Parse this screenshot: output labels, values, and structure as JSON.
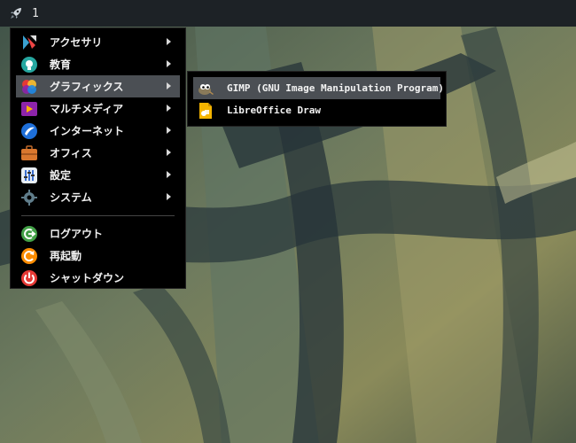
{
  "panel": {
    "launcher_icon": "rocket-icon",
    "workspace_number": "1"
  },
  "menu": {
    "items": [
      {
        "label": "アクセサリ",
        "icon": "accessories-icon",
        "has_submenu": true
      },
      {
        "label": "教育",
        "icon": "education-icon",
        "has_submenu": true
      },
      {
        "label": "グラフィックス",
        "icon": "graphics-icon",
        "has_submenu": true,
        "active": true
      },
      {
        "label": "マルチメディア",
        "icon": "multimedia-icon",
        "has_submenu": true
      },
      {
        "label": "インターネット",
        "icon": "internet-icon",
        "has_submenu": true
      },
      {
        "label": "オフィス",
        "icon": "office-icon",
        "has_submenu": true
      },
      {
        "label": "設定",
        "icon": "settings-icon",
        "has_submenu": true
      },
      {
        "label": "システム",
        "icon": "system-icon",
        "has_submenu": true
      }
    ],
    "session_items": [
      {
        "label": "ログアウト",
        "icon": "logout-icon"
      },
      {
        "label": "再起動",
        "icon": "restart-icon"
      },
      {
        "label": "シャットダウン",
        "icon": "shutdown-icon"
      }
    ]
  },
  "submenu": {
    "items": [
      {
        "label": "GIMP (GNU Image Manipulation Program)",
        "icon": "gimp-icon",
        "active": true
      },
      {
        "label": "LibreOffice Draw",
        "icon": "libreoffice-draw-icon"
      }
    ]
  },
  "colors": {
    "panel_bg": "#1d2226",
    "menu_bg": "#000000",
    "highlight": "#4b4f54"
  }
}
